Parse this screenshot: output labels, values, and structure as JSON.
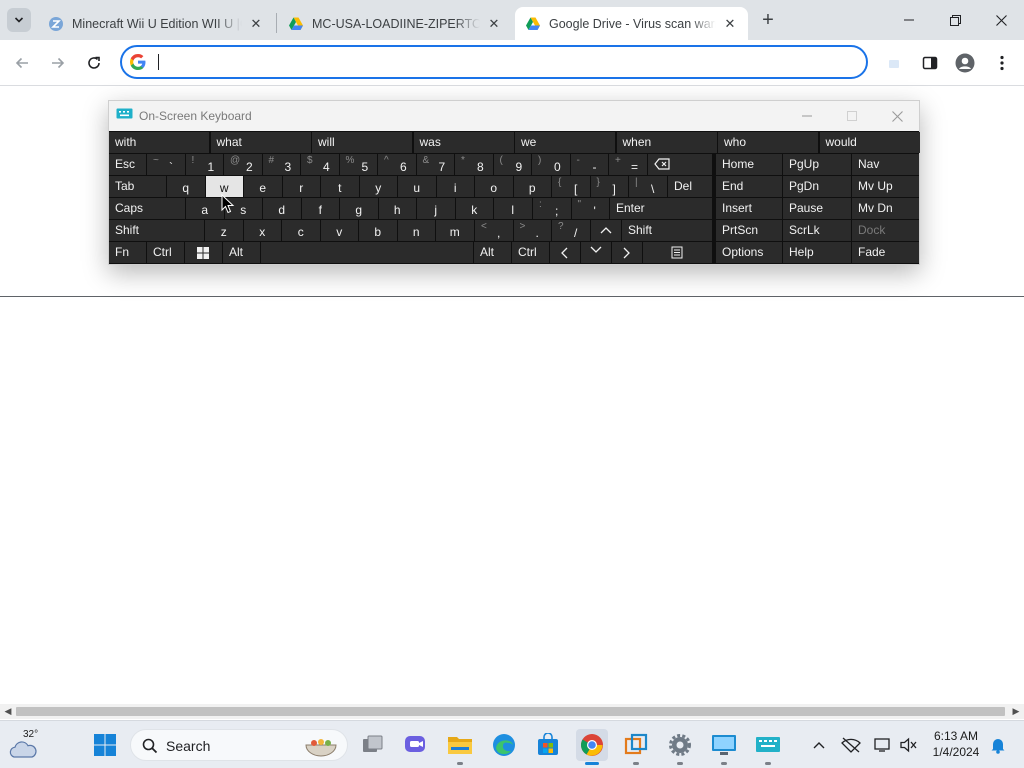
{
  "browser": {
    "tabs": [
      {
        "title": "Minecraft Wii U Edition WII U |G",
        "icon": "wiiu-favicon"
      },
      {
        "title": "MC-USA-LOADIINE-ZIPERTO.rar",
        "icon": "google-drive-favicon"
      },
      {
        "title": "Google Drive - Virus scan warni",
        "icon": "google-drive-favicon",
        "active": true
      }
    ],
    "new_tab_label": "+",
    "omnibox": {
      "value": "",
      "placeholder": ""
    }
  },
  "osk": {
    "title": "On-Screen Keyboard",
    "predictions": [
      "with",
      "what",
      "will",
      "was",
      "we",
      "when",
      "who",
      "would"
    ],
    "row1": {
      "esc": "Esc",
      "number_keys": [
        {
          "shift": "~",
          "base": "`"
        },
        {
          "shift": "!",
          "base": "1"
        },
        {
          "shift": "@",
          "base": "2"
        },
        {
          "shift": "#",
          "base": "3"
        },
        {
          "shift": "$",
          "base": "4"
        },
        {
          "shift": "%",
          "base": "5"
        },
        {
          "shift": "^",
          "base": "6"
        },
        {
          "shift": "&",
          "base": "7"
        },
        {
          "shift": "*",
          "base": "8"
        },
        {
          "shift": "(",
          "base": "9"
        },
        {
          "shift": ")",
          "base": "0"
        },
        {
          "shift": "-",
          "base": "-"
        },
        {
          "shift": "+",
          "base": "="
        }
      ]
    },
    "row2": {
      "tab": "Tab",
      "letters": [
        "q",
        "w",
        "e",
        "r",
        "t",
        "y",
        "u",
        "i",
        "o",
        "p"
      ],
      "brackets": [
        {
          "shift": "{",
          "base": "["
        },
        {
          "shift": "}",
          "base": "]"
        },
        {
          "shift": "|",
          "base": "\\"
        }
      ],
      "del": "Del"
    },
    "row3": {
      "caps": "Caps",
      "letters": [
        "a",
        "s",
        "d",
        "f",
        "g",
        "h",
        "j",
        "k",
        "l"
      ],
      "punct": [
        {
          "shift": ":",
          "base": ";"
        },
        {
          "shift": "\"",
          "base": "'"
        }
      ],
      "enter": "Enter"
    },
    "row4": {
      "shift_left": "Shift",
      "letters": [
        "z",
        "x",
        "c",
        "v",
        "b",
        "n",
        "m"
      ],
      "punct": [
        {
          "shift": "<",
          "base": ","
        },
        {
          "shift": ">",
          "base": "."
        },
        {
          "shift": "?",
          "base": "/"
        }
      ],
      "shift_right": "Shift"
    },
    "row5": {
      "fn": "Fn",
      "ctrl_left": "Ctrl",
      "alt_left": "Alt",
      "alt_right": "Alt",
      "ctrl_right": "Ctrl"
    },
    "nav_keys": [
      [
        "Home",
        "PgUp",
        "Nav"
      ],
      [
        "End",
        "PgDn",
        "Mv Up"
      ],
      [
        "Insert",
        "Pause",
        "Mv Dn"
      ],
      [
        "PrtScn",
        "ScrLk",
        "Dock"
      ],
      [
        "Options",
        "Help",
        "Fade"
      ]
    ],
    "pressed_key": "w"
  },
  "taskbar": {
    "weather_temp": "32°",
    "search_label": "Search",
    "clock_time": "6:13 AM",
    "clock_date": "1/4/2024"
  }
}
